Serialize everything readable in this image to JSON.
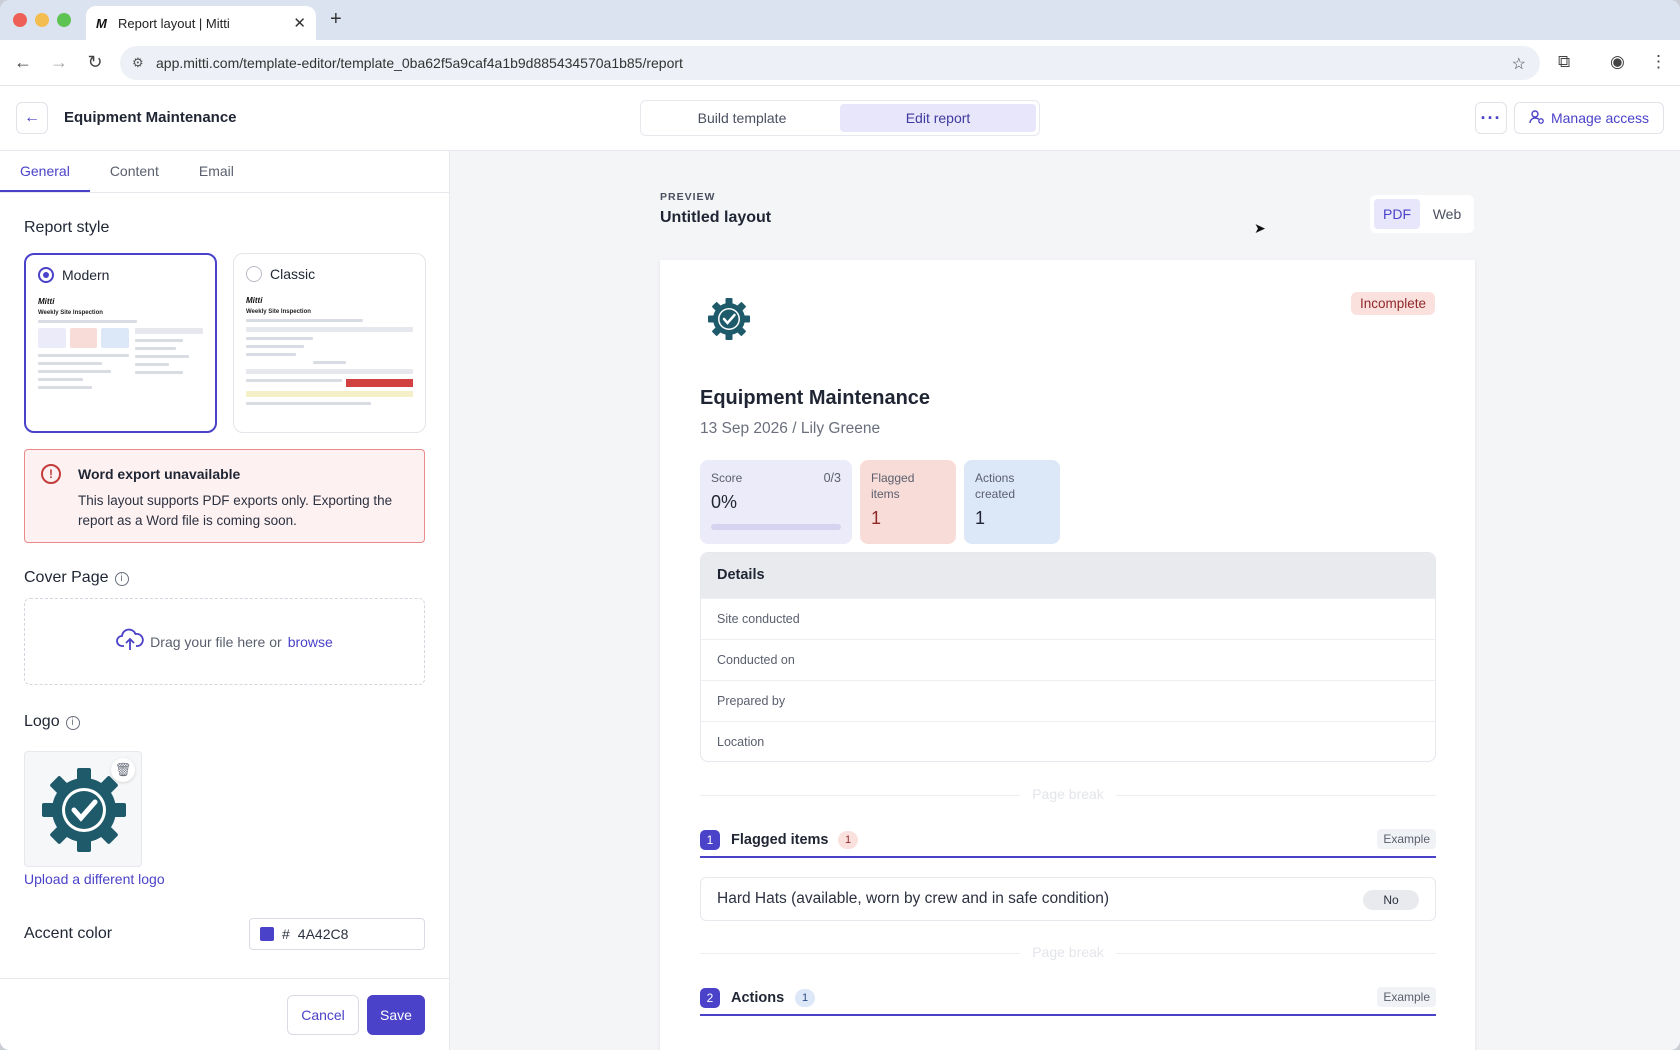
{
  "browser": {
    "tab_title": "Report layout | Mitti",
    "tab_favicon": "M",
    "url": "app.mitti.com/template-editor/template_0ba62f5a9caf4a1b9d885434570a1b85/report"
  },
  "header": {
    "title": "Equipment Maintenance",
    "modes": [
      "Build template",
      "Edit report"
    ],
    "active_mode": "Edit report",
    "manage_access": "Manage access"
  },
  "sidebar": {
    "tabs": [
      "General",
      "Content",
      "Email"
    ],
    "active_tab": "General",
    "report_style_heading": "Report style",
    "styles": [
      {
        "name": "Modern",
        "selected": true,
        "mini_brand": "Mitti",
        "mini_title": "Weekly Site Inspection"
      },
      {
        "name": "Classic",
        "selected": false,
        "mini_brand": "Mitti",
        "mini_title": "Weekly Site Inspection"
      }
    ],
    "alert": {
      "title": "Word export unavailable",
      "body": "This layout supports PDF exports only. Exporting the report as a Word file is coming soon."
    },
    "cover_page": {
      "heading": "Cover Page",
      "drop_text": "Drag your file here or",
      "browse": "browse"
    },
    "logo": {
      "heading": "Logo",
      "upload_link": "Upload a different logo"
    },
    "accent": {
      "label": "Accent color",
      "hash": "#",
      "value": "4A42C8",
      "color": "#4A42C8"
    },
    "footer": {
      "cancel": "Cancel",
      "save": "Save"
    }
  },
  "preview": {
    "caption": "PREVIEW",
    "layout_name": "Untitled layout",
    "formats": [
      "PDF",
      "Web"
    ],
    "active_format": "PDF",
    "report": {
      "status": "Incomplete",
      "title": "Equipment Maintenance",
      "subtitle": "13 Sep 2026 / Lily Greene",
      "score": {
        "label": "Score",
        "fraction": "0/3",
        "value": "0%",
        "progress": 0
      },
      "flagged": {
        "label": "Flagged items",
        "value": "1"
      },
      "actions": {
        "label": "Actions created",
        "value": "1"
      },
      "details": {
        "heading": "Details",
        "rows": [
          "Site conducted",
          "Conducted on",
          "Prepared by",
          "Location"
        ]
      },
      "page_break": "Page break",
      "sections": [
        {
          "number": "1",
          "title": "Flagged items",
          "count": "1",
          "tag": "Example"
        },
        {
          "number": "2",
          "title": "Actions",
          "count": "1",
          "tag": "Example"
        }
      ],
      "flagged_item": {
        "question": "Hard Hats (available, worn by crew and in safe condition)",
        "answer": "No"
      }
    }
  },
  "colors": {
    "accent": "#4A42C8",
    "logo_gear": "#1f5a6b"
  }
}
